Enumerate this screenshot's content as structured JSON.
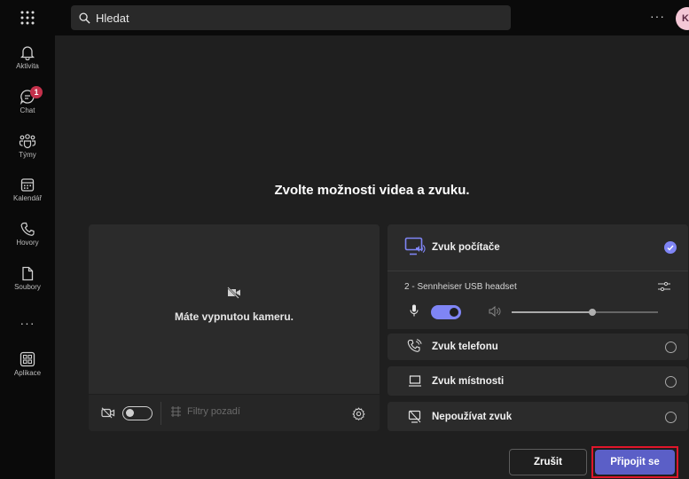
{
  "header": {
    "search_placeholder": "Hledat",
    "more_label": "···",
    "avatar_initial": "K"
  },
  "rail": {
    "items": [
      {
        "label": "Aktivita",
        "icon": "bell-icon"
      },
      {
        "label": "Chat",
        "icon": "chat-icon",
        "badge": "1"
      },
      {
        "label": "Týmy",
        "icon": "teams-icon"
      },
      {
        "label": "Kalendář",
        "icon": "calendar-icon"
      },
      {
        "label": "Hovory",
        "icon": "phone-icon"
      },
      {
        "label": "Soubory",
        "icon": "file-icon"
      },
      {
        "label": "",
        "icon": "more-icon"
      },
      {
        "label": "Aplikace",
        "icon": "apps-icon"
      }
    ],
    "more_label": "···"
  },
  "prejoin": {
    "title": "Zvolte možnosti videa a zvuku.",
    "camera_off_text": "Máte vypnutou kameru.",
    "camera_toggle": false,
    "filters_label": "Filtry pozadí"
  },
  "audio": {
    "computer_label": "Zvuk počítače",
    "computer_selected": true,
    "device_name": "2 - Sennheiser USB headset",
    "mic_on": true,
    "volume_level": 0.55,
    "phone_label": "Zvuk telefonu",
    "room_label": "Zvuk místnosti",
    "none_label": "Nepoužívat zvuk"
  },
  "actions": {
    "cancel_label": "Zrušit",
    "join_label": "Připojit se"
  },
  "colors": {
    "accent": "#7f85f5",
    "primary_button": "#5b5fc7",
    "badge": "#c4314b",
    "highlight_border": "#e0162b"
  }
}
